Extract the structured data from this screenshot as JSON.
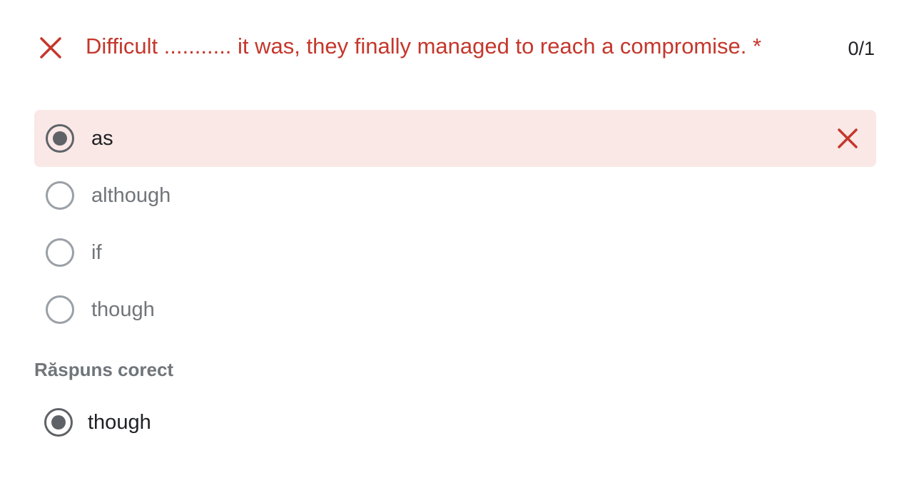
{
  "question": {
    "status_icon": "close-icon",
    "text": "Difficult ........... it was, they finally managed to reach a compromise. *",
    "score": "0/1"
  },
  "options": [
    {
      "label": "as",
      "selected": true,
      "incorrect": true
    },
    {
      "label": "although",
      "selected": false,
      "incorrect": false
    },
    {
      "label": "if",
      "selected": false,
      "incorrect": false
    },
    {
      "label": "though",
      "selected": false,
      "incorrect": false
    }
  ],
  "correct_answer": {
    "heading": "Răspuns corect",
    "label": "though"
  },
  "colors": {
    "error": "#c5372c",
    "error_background": "#f9e8e6",
    "radio_checked": "#5f6368",
    "radio_unchecked": "#9aa0a6"
  }
}
